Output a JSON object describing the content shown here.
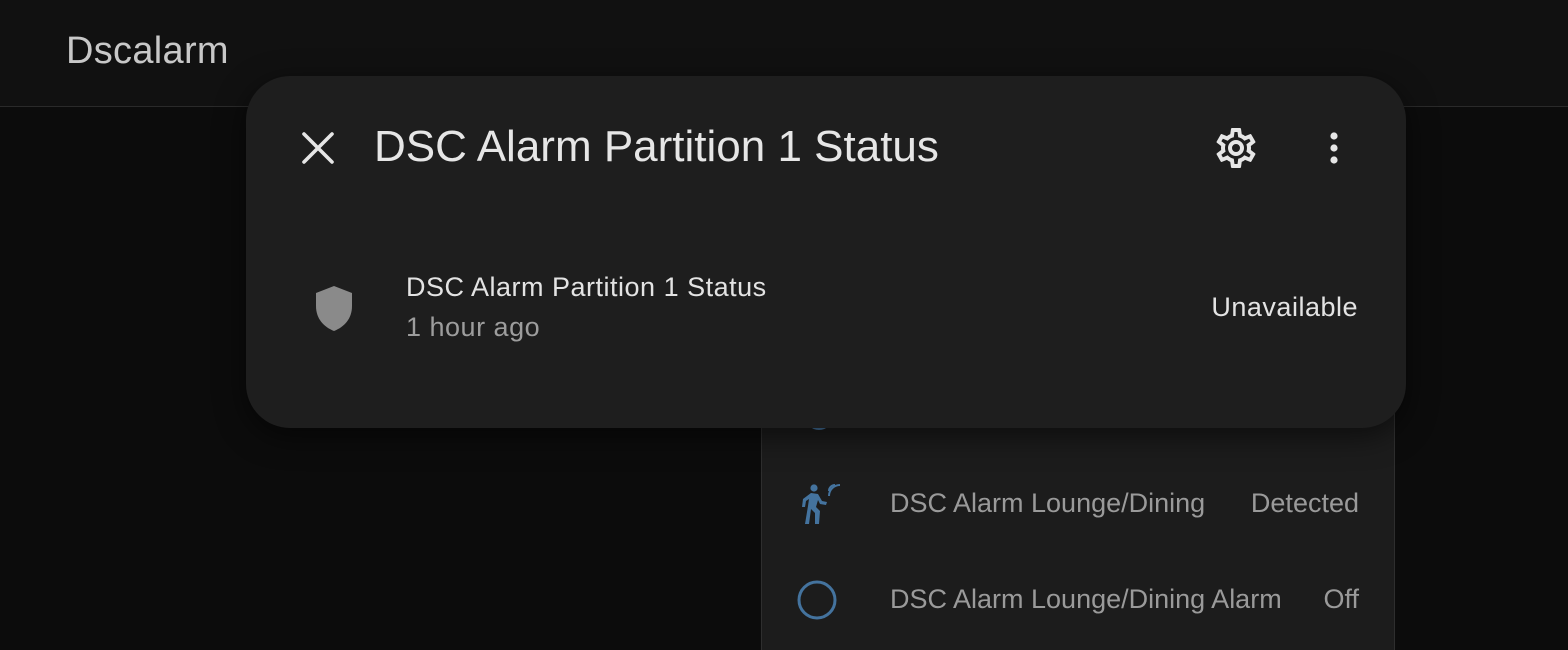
{
  "header": {
    "title": "Dscalarm"
  },
  "dialog": {
    "title": "DSC Alarm Partition 1 Status",
    "icons": {
      "close": "close-icon",
      "settings": "gear-icon",
      "more": "dots-vertical-icon"
    },
    "entity": {
      "icon": "shield-icon",
      "name": "DSC Alarm Partition 1 Status",
      "last_changed": "1 hour ago",
      "state": "Unavailable"
    }
  },
  "background_card": {
    "rows": [
      {
        "icon": "motion-sensor-icon",
        "name": "DSC Alarm Lounge/Dining",
        "state": "Detected"
      },
      {
        "icon": "circle-outline-icon",
        "name": "DSC Alarm Lounge/Dining Alarm",
        "state": "Off"
      }
    ]
  },
  "colors": {
    "accent_blue": "#44739e",
    "dialog_bg": "#1e1e1e",
    "page_bg": "#0c0c0c",
    "header_bg": "#111111",
    "shield_gray": "#8a8a8a"
  }
}
